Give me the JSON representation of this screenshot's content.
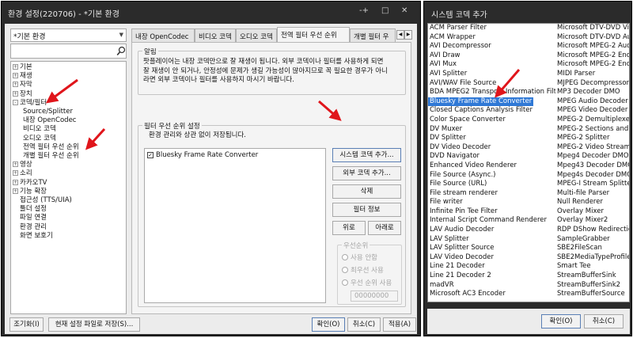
{
  "left": {
    "title": "환경 설정(220706) - *기본 환경",
    "title_buttons": [
      "-+",
      "□",
      "✕"
    ],
    "config_combo": "*기본 환경",
    "tree": [
      {
        "label": "기본",
        "exp": "+",
        "level": 0
      },
      {
        "label": "재생",
        "exp": "+",
        "level": 0
      },
      {
        "label": "자막",
        "exp": "+",
        "level": 0
      },
      {
        "label": "장치",
        "exp": "+",
        "level": 0
      },
      {
        "label": "코덱/필터",
        "exp": "−",
        "level": 0
      },
      {
        "label": "Source/Splitter",
        "exp": "",
        "level": 1
      },
      {
        "label": "내장 OpenCodec",
        "exp": "",
        "level": 1
      },
      {
        "label": "비디오 코덱",
        "exp": "",
        "level": 1
      },
      {
        "label": "오디오 코덱",
        "exp": "",
        "level": 1
      },
      {
        "label": "전역 필터 우선 순위",
        "exp": "",
        "level": 1
      },
      {
        "label": "개별 필터 우선 순위",
        "exp": "",
        "level": 1
      },
      {
        "label": "영상",
        "exp": "+",
        "level": 0
      },
      {
        "label": "소리",
        "exp": "+",
        "level": 0
      },
      {
        "label": "카카오TV",
        "exp": "+",
        "level": 0
      },
      {
        "label": "기능 확장",
        "exp": "+",
        "level": 0
      },
      {
        "label": "접근성 (TTS/UIA)",
        "exp": "",
        "level": 0
      },
      {
        "label": "툴더 설정",
        "exp": "",
        "level": 0
      },
      {
        "label": "파일 연결",
        "exp": "",
        "level": 0
      },
      {
        "label": "환경 관리",
        "exp": "",
        "level": 0
      },
      {
        "label": "화면 보호기",
        "exp": "",
        "level": 0
      }
    ],
    "tabs": [
      "내장 OpenCodec",
      "비디오 코덱",
      "오디오 코덱",
      "전역 필터 우선 순위",
      "개별 필터 우"
    ],
    "notice": {
      "title": "알림",
      "lines": [
        "팟플레이어는 내장 코덱만으로 잘 재생이 됩니다. 외부 코덱이나 필터를 사용하게 되면",
        "잘 재생이 안 되거나, 안정성에 문제가 생길 가능성이 많아지므로 꼭 필요한 경우가 아니",
        "라면 외부 코덱이나 필터를 사용하지 마시기 바랍니다."
      ]
    },
    "filter_group": {
      "title": "필터 우선 순위 설정",
      "desc": "환경 관리와 상관 없이 저장됩니다.",
      "items": [
        {
          "label": "Bluesky Frame Rate Converter",
          "checked": true
        }
      ]
    },
    "side_buttons": {
      "add_system": "시스템 코덱 추가...",
      "add_external": "외부 코덱 추가...",
      "delete": "삭제",
      "filter_info": "필터 정보",
      "up": "위로",
      "down": "아래로"
    },
    "priority": {
      "title": "우선순위",
      "options": [
        "사용 안함",
        "최우선 사용",
        "우선 순위 사용"
      ],
      "value": "00000000"
    },
    "bottom": {
      "reset": "조기화(I)",
      "save_current": "현재 설정 파일로 저장(S)...",
      "ok": "확인(O)",
      "cancel": "취소(C)",
      "apply": "적용(A)"
    }
  },
  "right": {
    "title": "시스템 코덱 추가",
    "col1": [
      "ACM Parser Filter",
      "ACM Wrapper",
      "AVI Decompressor",
      "AVI Draw",
      "AVI Mux",
      "AVI Splitter",
      "AVI/WAV File Source",
      "BDA MPEG2 Transport Information Filter",
      "Bluesky Frame Rate Converter",
      "Closed Captions Analysis Filter",
      "Color Space Converter",
      "DV Muxer",
      "DV Splitter",
      "DV Video Decoder",
      "DVD Navigator",
      "Enhanced Video Renderer",
      "File Source (Async.)",
      "File Source (URL)",
      "File stream renderer",
      "File writer",
      "Infinite Pin Tee Filter",
      "Internal Script Command Renderer",
      "LAV Audio Decoder",
      "LAV Splitter",
      "LAV Splitter Source",
      "LAV Video Decoder",
      "Line 21 Decoder",
      "Line 21 Decoder 2",
      "madVR",
      "Microsoft AC3 Encoder"
    ],
    "col2": [
      "Microsoft DTV-DVD Video",
      "Microsoft DTV-DVD Audi",
      "Microsoft MPEG-2 Audi",
      "Microsoft MPEG-2 Encode",
      "Microsoft MPEG-2 Encod",
      "MIDI Parser",
      "MJPEG Decompressor",
      "MP3 Decoder DMO",
      "MPEG Audio Decoder",
      "MPEG Video Decoder",
      "MPEG-2 Demultiplexer",
      "MPEG-2 Sections and Ta",
      "MPEG-2 Splitter",
      "MPEG-2 Video Stream A",
      "Mpeg4 Decoder DMO",
      "Mpeg43 Decoder DMO",
      "Mpeg4s Decoder DMO",
      "MPEG-I Stream Splitter",
      "Multi-file Parser",
      "Null Renderer",
      "Overlay Mixer",
      "Overlay Mixer2",
      "RDP DShow Redirection Filter",
      "SampleGrabber",
      "SBE2FileScan",
      "SBE2MediaTypeProfile",
      "Smart Tee",
      "StreamBufferSink",
      "StreamBufferSink2",
      "StreamBufferSource"
    ],
    "selected": "Bluesky Frame Rate Converter",
    "ok": "확인(O)",
    "cancel": "취소(C)"
  },
  "colors": {
    "arrow": "#e0151b",
    "titlebar": "#2b2b2b",
    "selection": "#3079d6"
  }
}
